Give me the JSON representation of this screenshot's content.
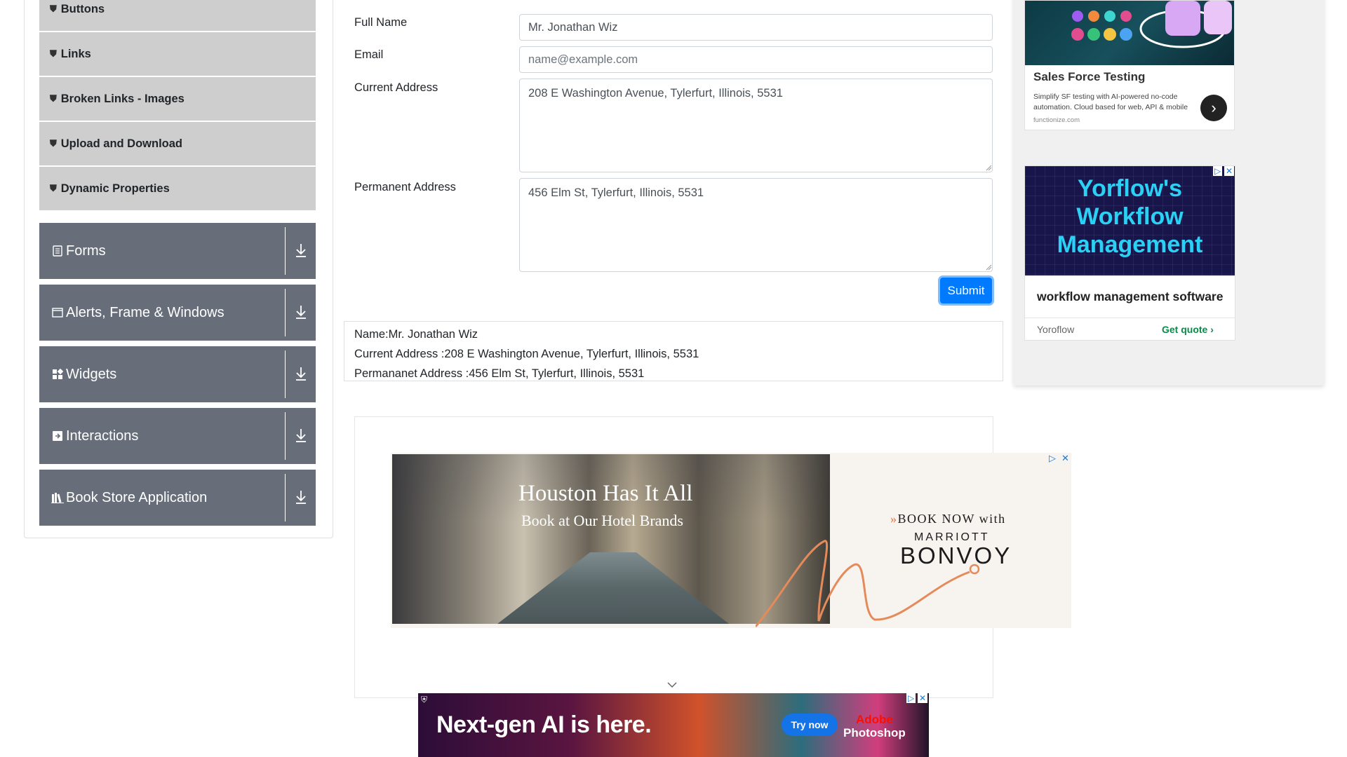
{
  "sidebar": {
    "sub_items": [
      {
        "label": "Buttons"
      },
      {
        "label": "Links"
      },
      {
        "label": "Broken Links - Images"
      },
      {
        "label": "Upload and Download"
      },
      {
        "label": "Dynamic Properties"
      }
    ],
    "groups": [
      {
        "label": "Forms",
        "icon": "form-icon"
      },
      {
        "label": "Alerts, Frame & Windows",
        "icon": "window-icon"
      },
      {
        "label": "Widgets",
        "icon": "widgets-icon"
      },
      {
        "label": "Interactions",
        "icon": "interactions-icon"
      },
      {
        "label": "Book Store Application",
        "icon": "books-icon"
      }
    ]
  },
  "form": {
    "full_name_label": "Full Name",
    "full_name_value": "Mr. Jonathan Wiz",
    "email_label": "Email",
    "email_value": "",
    "email_placeholder": "name@example.com",
    "current_address_label": "Current Address",
    "current_address_value": "208 E Washington Avenue, Tylerfurt, Illinois, 5531",
    "permanent_address_label": "Permanent Address",
    "permanent_address_value": "456 Elm St, Tylerfurt, Illinois, 5531",
    "submit_label": "Submit"
  },
  "output": {
    "name": "Name:Mr. Jonathan Wiz",
    "current_address": "Current Address :208 E Washington Avenue, Tylerfurt, Illinois, 5531",
    "permanent_address": "Permananet Address :456 Elm St, Tylerfurt, Illinois, 5531"
  },
  "ads": {
    "hotel": {
      "title": "Houston Has It All",
      "subtitle": "Book at Our Hotel Brands",
      "book_now": "BOOK NOW with",
      "marriott": "MARRIOTT",
      "bonvoy": "BONVOY"
    },
    "photoshop": {
      "headline": "Next-gen AI is here.",
      "cta": "Try now",
      "brand_line1": "Adobe",
      "brand_line2": "Photoshop"
    },
    "salesforce": {
      "title": "Sales Force Testing",
      "body": "Simplify SF testing with AI-powered no-code automation. Cloud based for web, API & mobile",
      "domain": "functionize.com"
    },
    "yoroflow": {
      "headline": "Yorflow's Workflow Management",
      "description": "workflow management software",
      "brand": "Yoroflow",
      "cta": "Get quote"
    }
  },
  "colors": {
    "accordion_sub_bg": "#cecece",
    "accordion_group_bg": "#676e7a",
    "submit_bg": "#007bff"
  }
}
